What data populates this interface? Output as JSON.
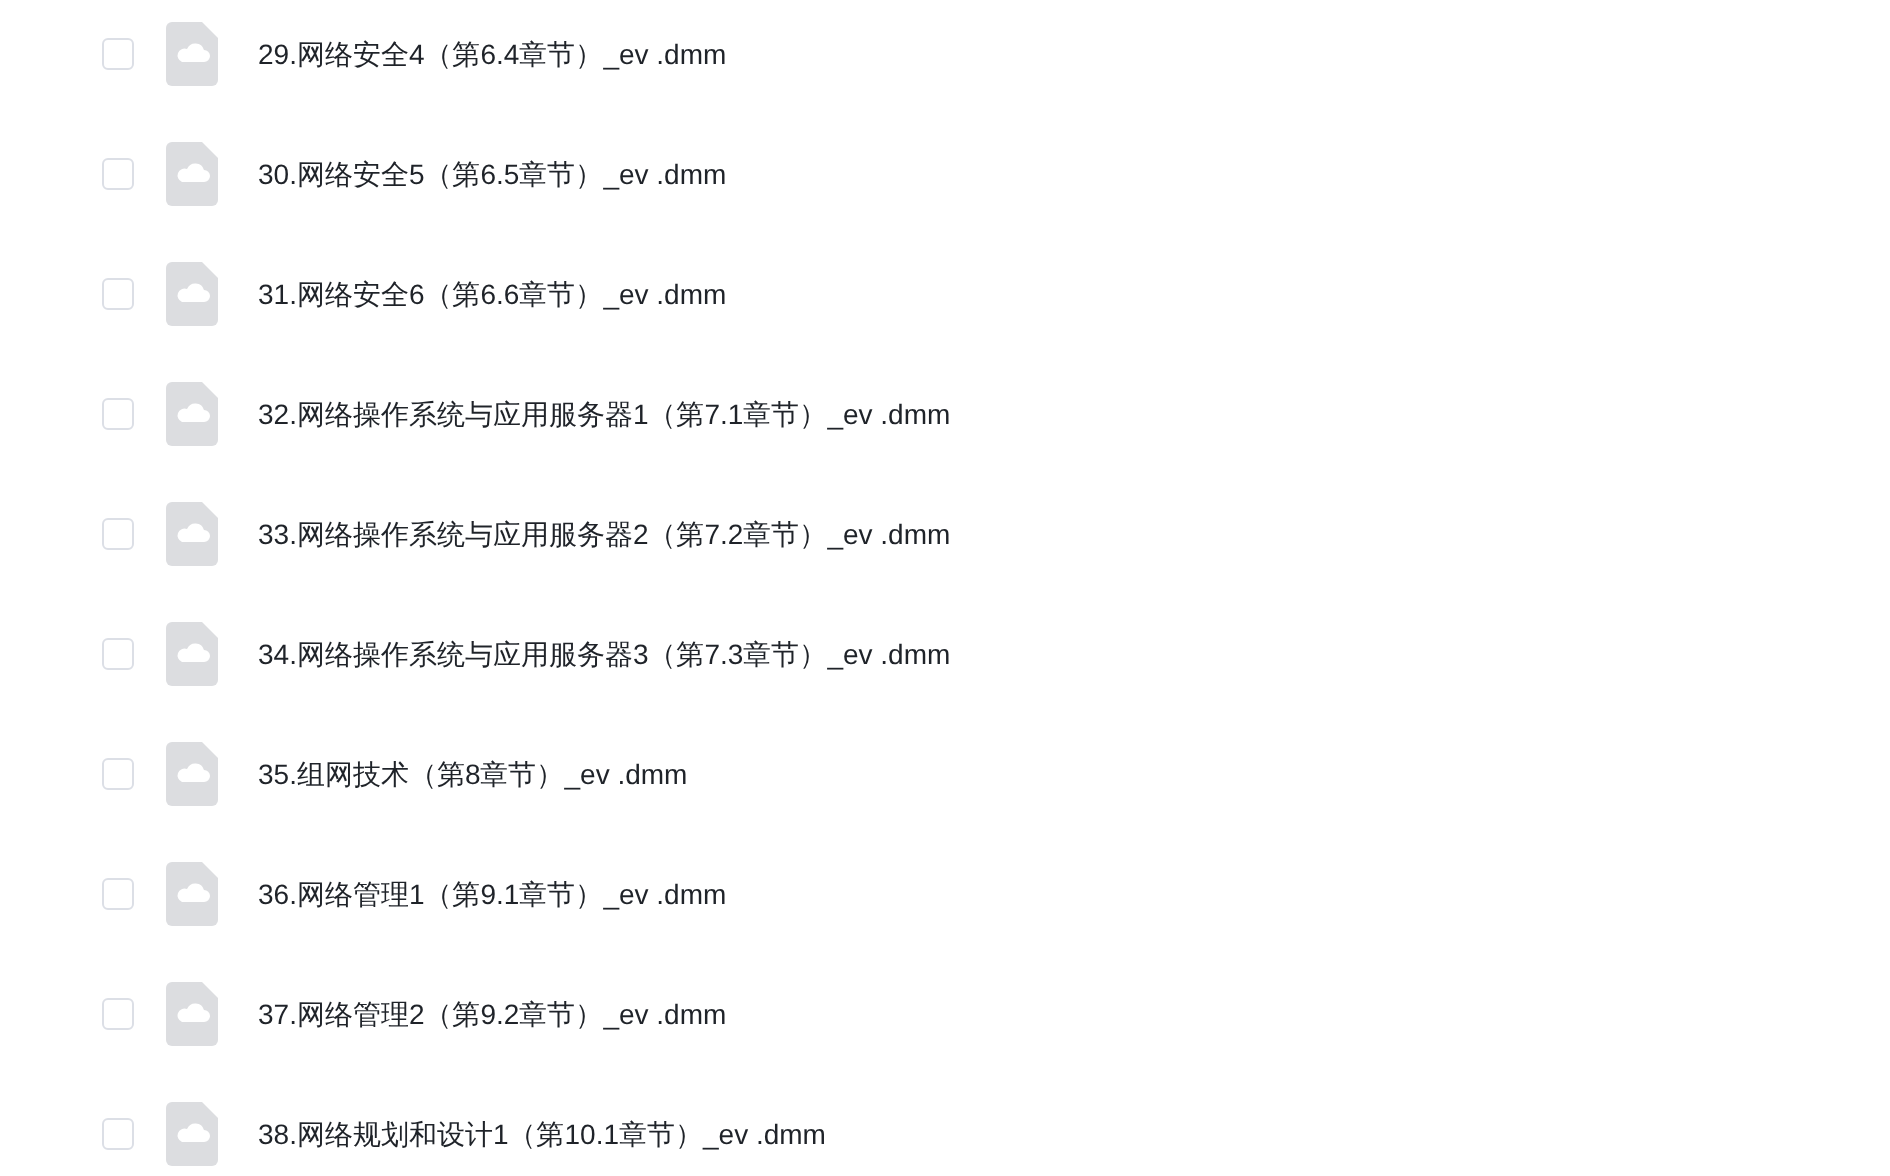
{
  "files": [
    {
      "name": "29.网络安全4（第6.4章节）_ev .dmm",
      "checked": false
    },
    {
      "name": "30.网络安全5（第6.5章节）_ev .dmm",
      "checked": false
    },
    {
      "name": "31.网络安全6（第6.6章节）_ev .dmm",
      "checked": false
    },
    {
      "name": "32.网络操作系统与应用服务器1（第7.1章节）_ev .dmm",
      "checked": false
    },
    {
      "name": "33.网络操作系统与应用服务器2（第7.2章节）_ev .dmm",
      "checked": false
    },
    {
      "name": "34.网络操作系统与应用服务器3（第7.3章节）_ev .dmm",
      "checked": false
    },
    {
      "name": "35.组网技术（第8章节）_ev .dmm",
      "checked": false
    },
    {
      "name": "36.网络管理1（第9.1章节）_ev .dmm",
      "checked": false
    },
    {
      "name": "37.网络管理2（第9.2章节）_ev .dmm",
      "checked": false
    },
    {
      "name": "38.网络规划和设计1（第10.1章节）_ev .dmm",
      "checked": false
    }
  ]
}
